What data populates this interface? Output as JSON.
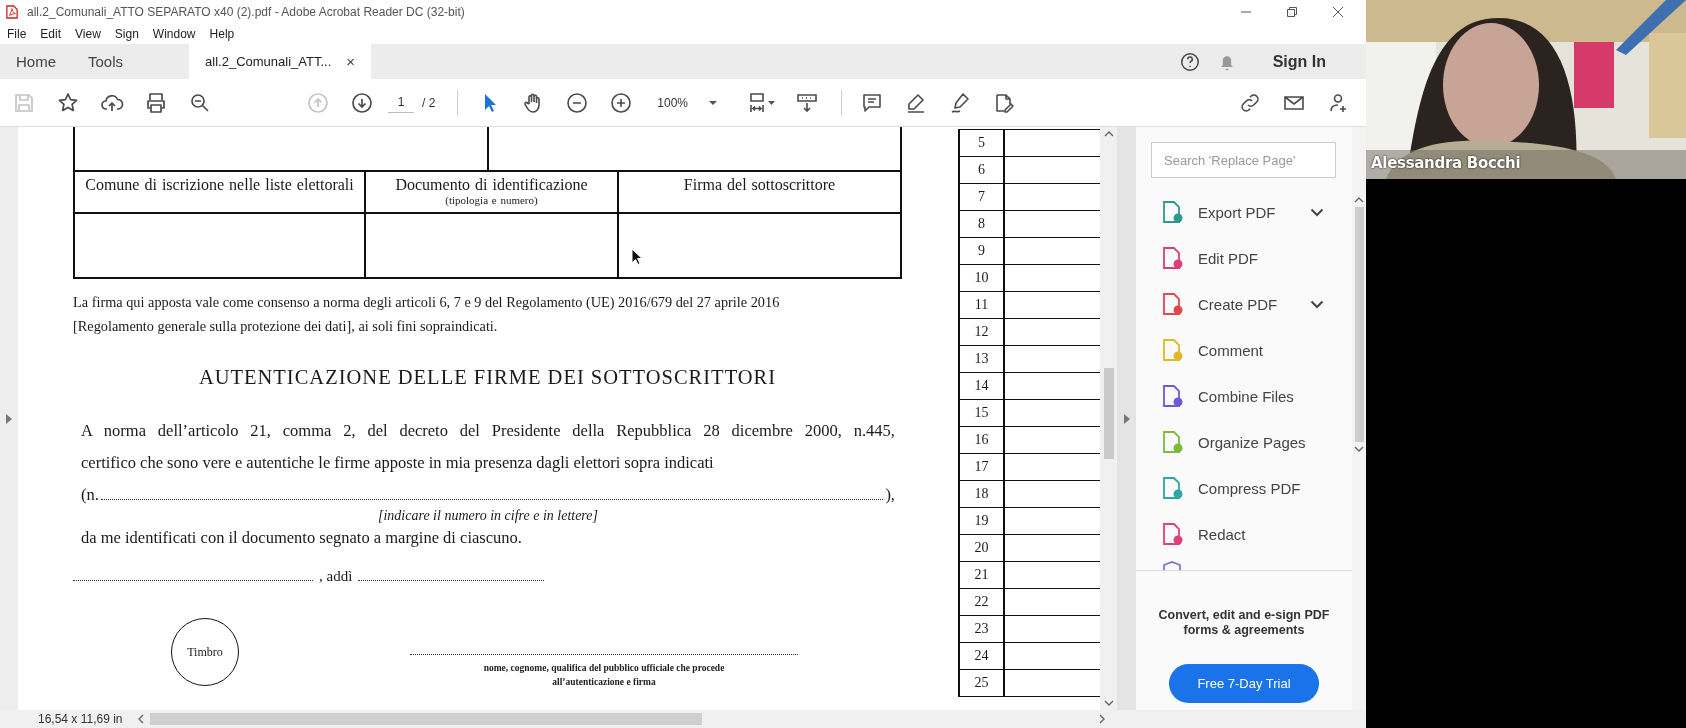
{
  "window": {
    "title": "all.2_Comunali_ATTO SEPARATO x40 (2).pdf - Adobe Acrobat Reader DC (32-bit)"
  },
  "menu": [
    "File",
    "Edit",
    "View",
    "Sign",
    "Window",
    "Help"
  ],
  "tabs": [
    {
      "label": "Home",
      "selected": false
    },
    {
      "label": "Tools",
      "selected": false
    },
    {
      "label": "all.2_Comunali_ATT...",
      "selected": true,
      "close": "×"
    }
  ],
  "sign_in": "Sign In",
  "toolbar": {
    "file_buttons": [
      {
        "disabled": true
      },
      {
        "disabled": false
      },
      {
        "disabled": false
      },
      {
        "disabled": false
      },
      {
        "disabled": false
      }
    ],
    "nav_buttons": [
      {
        "disabled": true
      },
      {
        "disabled": false
      }
    ],
    "page_value": "1",
    "page_total": "/ 2",
    "zoom": "100%"
  },
  "document": {
    "form_columns": [
      "Comune di iscrizione  nelle  liste  elettorali",
      "Documento di identificazione",
      "Firma del sottoscrittore"
    ],
    "form_column_note": "(tipologia e numero)",
    "consent_lines": [
      "La firma qui apposta vale come consenso a norma degli articoli 6, 7 e 9 del Regolamento (UE) 2016/679 del 27 aprile 2016",
      "[Regolamento generale sulla protezione dei dati], ai soli fini sopraindicati."
    ],
    "heading": "AUTENTICAZIONE DELLE FIRME DEI SOTTOSCRITTORI",
    "paragraph_lines": [
      "A norma dell’articolo 21, comma 2, del decreto del Presidente della Repubblica 28 dicembre 2000, n.445,",
      "certifico che sono vere e autentiche le firme apposte in mia presenza dagli elettori sopra indicati"
    ],
    "count_open": "(n.",
    "count_close": "),",
    "count_hint": "[indicare il numero in cifre e in lettere]",
    "identified_line": "da me identificati con il documento segnato a margine di ciascuno.",
    "date_label": ", addì",
    "stamp": "Timbro",
    "signature_caption": [
      "nome, cognome, qualifica del pubblico ufficiale che procede",
      "all’autenticazione e firma"
    ],
    "row_numbers": [
      "5",
      "6",
      "7",
      "8",
      "9",
      "10",
      "11",
      "12",
      "13",
      "14",
      "15",
      "16",
      "17",
      "18",
      "19",
      "20",
      "21",
      "22",
      "23",
      "24",
      "25"
    ]
  },
  "tools_panel": {
    "search": {
      "placeholder": "Search 'Replace Page'"
    },
    "tools": [
      {
        "label": "Export PDF",
        "color": "#2d9a8e",
        "expandable": true
      },
      {
        "label": "Edit PDF",
        "color": "#d9407a",
        "expandable": false
      },
      {
        "label": "Create PDF",
        "color": "#e0464e",
        "expandable": true
      },
      {
        "label": "Comment",
        "color": "#e0b928",
        "expandable": false
      },
      {
        "label": "Combine Files",
        "color": "#6b5bd6",
        "expandable": false
      },
      {
        "label": "Organize Pages",
        "color": "#7dba3c",
        "expandable": false
      },
      {
        "label": "Compress PDF",
        "color": "#2aa7a0",
        "expandable": false
      },
      {
        "label": "Redact",
        "color": "#e0407a",
        "expandable": false
      }
    ],
    "promo": "Convert, edit and e-sign PDF forms & agreements",
    "trial_button": "Free 7-Day Trial"
  },
  "status_bar": {
    "page_size": "16,54 x 11,69 in"
  },
  "video_call": {
    "participant": "Alessandra Bocchi",
    "kind": "picture"
  }
}
